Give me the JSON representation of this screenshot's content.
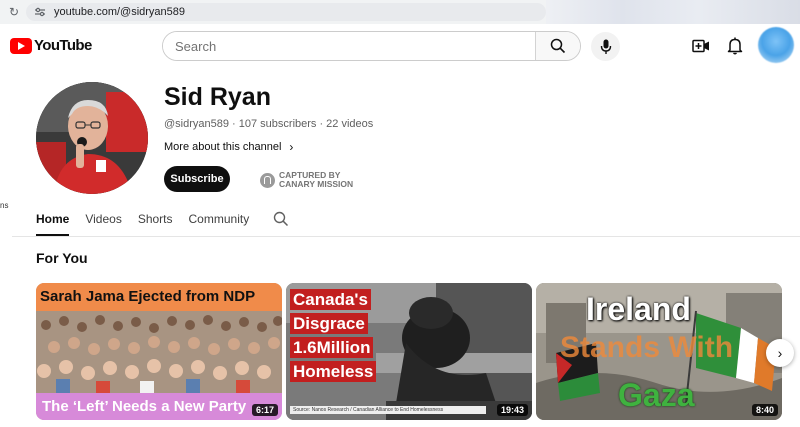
{
  "browser": {
    "url": "youtube.com/@sidryan589"
  },
  "header": {
    "logo_text": "YouTube",
    "search_placeholder": "Search"
  },
  "sidebar_fragment": "ns",
  "channel": {
    "name": "Sid Ryan",
    "meta": "@sidryan589 · 107 subscribers · 22 videos",
    "more_about": "More about this channel",
    "subscribe_label": "Subscribe",
    "captured_line1": "CAPTURED BY",
    "captured_line2": "CANARY MISSION"
  },
  "tabs": [
    {
      "label": "Home",
      "active": true
    },
    {
      "label": "Videos",
      "active": false
    },
    {
      "label": "Shorts",
      "active": false
    },
    {
      "label": "Community",
      "active": false
    }
  ],
  "section": {
    "title": "For You"
  },
  "videos": [
    {
      "top_text": "Sarah Jama Ejected from NDP",
      "bottom_text": "The ‘Left’ Needs a New Party",
      "duration": "6:17"
    },
    {
      "lines": [
        "Canada's",
        "Disgrace",
        "1.6Million",
        "Homeless"
      ],
      "source": "Source: Nanos Research / Canadian Alliance to End Homelessness",
      "duration": "19:43"
    },
    {
      "line1": "Ireland",
      "line2": "Stands With",
      "line3": "Gaza",
      "duration": "8:40"
    }
  ],
  "colors": {
    "logo_red": "#ff0000",
    "subscribe_bg": "#0f0f0f",
    "card1_top": "#f08b4a",
    "card1_bottom": "#d78ad9",
    "card2_red": "#c21f1f"
  },
  "icons": {
    "reload": "reload-icon",
    "search": "search-icon",
    "mic": "mic-icon",
    "create": "create-video-icon",
    "bell": "bell-icon",
    "chevron": "chevron-right-icon"
  }
}
